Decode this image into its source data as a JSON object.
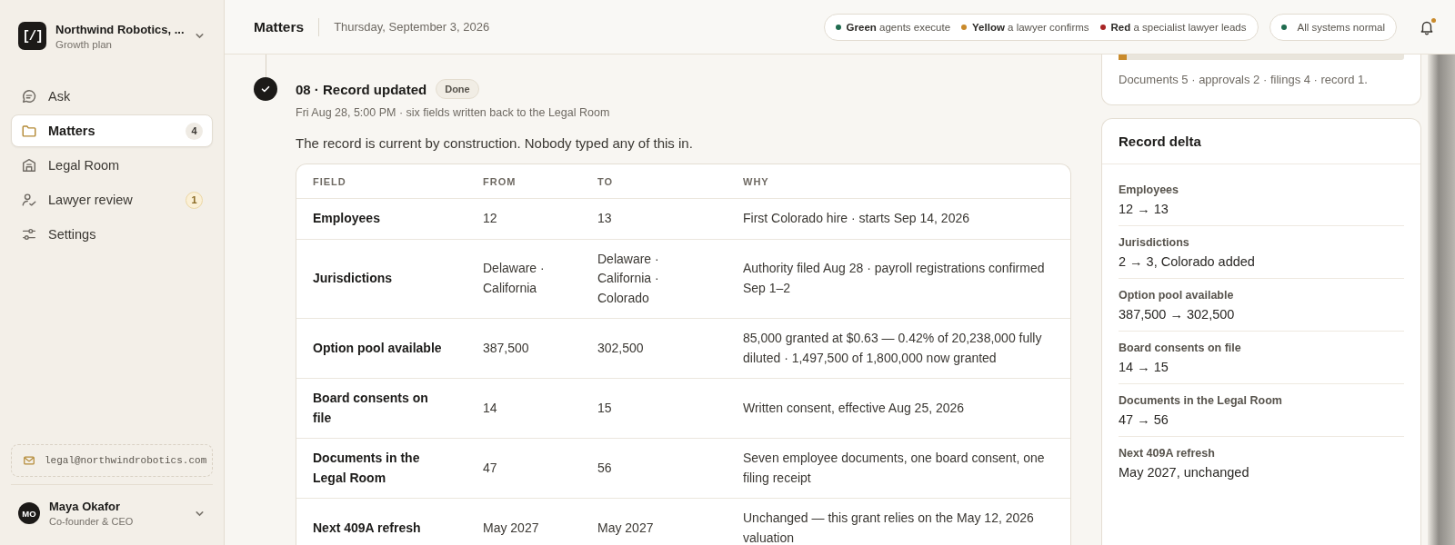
{
  "workspace": {
    "name": "Northwind Robotics, ...",
    "plan": "Growth plan",
    "logo": "[/]"
  },
  "nav": [
    {
      "kind": "ask",
      "label": "Ask",
      "selected": false
    },
    {
      "kind": "folder",
      "label": "Matters",
      "selected": true,
      "badge": "4",
      "badge_highlighted": false
    },
    {
      "kind": "building",
      "label": "Legal Room",
      "selected": false
    },
    {
      "kind": "reviewer",
      "label": "Lawyer review",
      "selected": false,
      "badge": "1",
      "badge_highlighted": true
    },
    {
      "kind": "sliders",
      "label": "Settings",
      "selected": false
    }
  ],
  "inbox_email": "legal@northwindrobotics.com",
  "user": {
    "initials": "MO",
    "name": "Maya Okafor",
    "role": "Co-founder & CEO"
  },
  "header": {
    "title": "Matters",
    "date": "Thursday, September 3, 2026",
    "legend": [
      {
        "label": "Green",
        "text": "agents execute",
        "color": "#1f6b4f"
      },
      {
        "label": "Yellow",
        "text": "a lawyer confirms",
        "color": "#c98a2b"
      },
      {
        "label": "Red",
        "text": "a specialist lawyer leads",
        "color": "#a82424"
      }
    ],
    "status": {
      "text": "All systems normal",
      "color": "#1f6b4f"
    },
    "notifications_unread": true
  },
  "step": {
    "title": "08 · Record updated",
    "status": "Done",
    "done": true,
    "meta": "Fri Aug 28, 5:00 PM · six fields written back to the Legal Room",
    "summary": "The record is current by construction. Nobody typed any of this in.",
    "table": {
      "columns": [
        "FIELD",
        "FROM",
        "TO",
        "WHY"
      ],
      "rows": [
        [
          "Employees",
          "12",
          "13",
          "First Colorado hire · starts Sep 14, 2026"
        ],
        [
          "Jurisdictions",
          "Delaware · California",
          "Delaware · California · Colorado",
          "Authority filed Aug 28 · payroll registrations confirmed Sep 1–2"
        ],
        [
          "Option pool available",
          "387,500",
          "302,500",
          "85,000 granted at $0.63 — 0.42% of 20,238,000 fully diluted · 1,497,500 of 1,800,000 now granted"
        ],
        [
          "Board consents on file",
          "14",
          "15",
          "Written consent, effective Aug 25, 2026"
        ],
        [
          "Documents in the Legal Room",
          "47",
          "56",
          "Seven employee documents, one board consent, one filing receipt"
        ],
        [
          "Next 409A refresh",
          "May 2027",
          "May 2027",
          "Unchanged — this grant relies on the May 12, 2026 valuation"
        ]
      ]
    }
  },
  "progress_card": {
    "level": 0.03,
    "summary": "Documents 5 · approvals 2 · filings 4 · record 1."
  },
  "record_delta": {
    "title": "Record delta",
    "items": [
      {
        "label": "Employees",
        "value": "12 → 13"
      },
      {
        "label": "Jurisdictions",
        "value": "2 → 3, Colorado added"
      },
      {
        "label": "Option pool available",
        "value": "387,500 → 302,500"
      },
      {
        "label": "Board consents on file",
        "value": "14 → 15"
      },
      {
        "label": "Documents in the Legal Room",
        "value": "47 → 56"
      },
      {
        "label": "Next 409A refresh",
        "value": "May 2027, unchanged"
      }
    ]
  }
}
